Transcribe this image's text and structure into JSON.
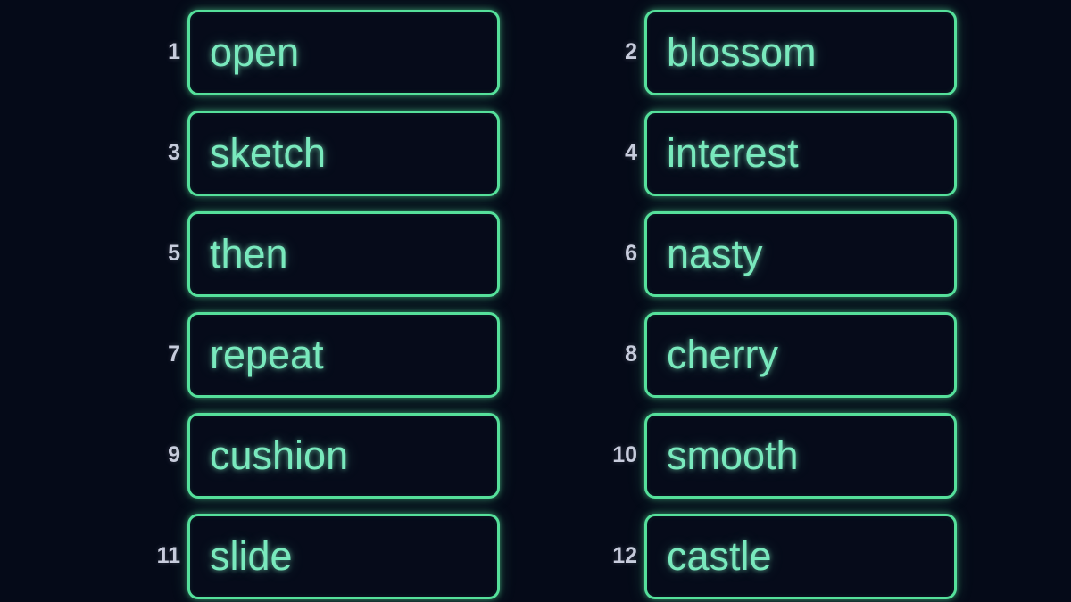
{
  "theme": {
    "background_color": "#050a18",
    "box_border_color": "#55e09b",
    "box_fill_color": "#060b1a",
    "word_text_color": "#79e9bd",
    "number_text_color": "#c8ccdd"
  },
  "word_list": {
    "columns": 2,
    "rows": 6,
    "items": [
      {
        "number": "1",
        "word": "open"
      },
      {
        "number": "2",
        "word": "blossom"
      },
      {
        "number": "3",
        "word": "sketch"
      },
      {
        "number": "4",
        "word": "interest"
      },
      {
        "number": "5",
        "word": "then"
      },
      {
        "number": "6",
        "word": "nasty"
      },
      {
        "number": "7",
        "word": "repeat"
      },
      {
        "number": "8",
        "word": "cherry"
      },
      {
        "number": "9",
        "word": "cushion"
      },
      {
        "number": "10",
        "word": "smooth"
      },
      {
        "number": "11",
        "word": "slide"
      },
      {
        "number": "12",
        "word": "castle"
      }
    ]
  }
}
